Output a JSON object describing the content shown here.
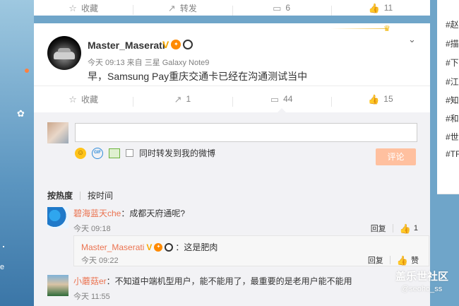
{
  "top_actions": {
    "favorite": "收藏",
    "repost": "转发",
    "comment": "6",
    "like": "11"
  },
  "post": {
    "user_name": "Master_Maserati",
    "meta": "今天 09:13 来自 三星 Galaxy Note9",
    "text": "早，Samsung Pay重庆交通卡已经在沟通测试当中"
  },
  "post_actions": {
    "favorite": "收藏",
    "repost": "1",
    "comment": "44",
    "like": "15"
  },
  "composer": {
    "sync_label": "同时转发到我的微博",
    "submit_label": "评论"
  },
  "sort": {
    "active": "按热度",
    "other": "按时间"
  },
  "comments": [
    {
      "user": "碧海蓝天che",
      "text": "：成都天府通呢?",
      "time": "今天 09:18",
      "reply": "回复",
      "likes": "1"
    },
    {
      "user": "小蘑菇er",
      "text": "：不知道中端机型用户，能不能用了，最重要的是老用户能不能用",
      "time": "今天 11:55"
    }
  ],
  "reply": {
    "user": "Master_Maserati",
    "text": "：这是肥肉",
    "time": "今天 09:22",
    "reply": "回复",
    "like": "赞"
  },
  "sidebar": {
    "items": [
      "#赵",
      "#描",
      "#下",
      "#江",
      "#知",
      "#和",
      "#世",
      "#TF"
    ]
  },
  "left_rail": {
    "label": "e"
  },
  "watermark": {
    "title": "盖乐世社区",
    "sub": "@seoho_ss"
  },
  "colors": {
    "accent": "#eb7350",
    "submit_disabled": "#ffc09f",
    "vip": "#f7a800",
    "background": "#6fa5c9"
  }
}
